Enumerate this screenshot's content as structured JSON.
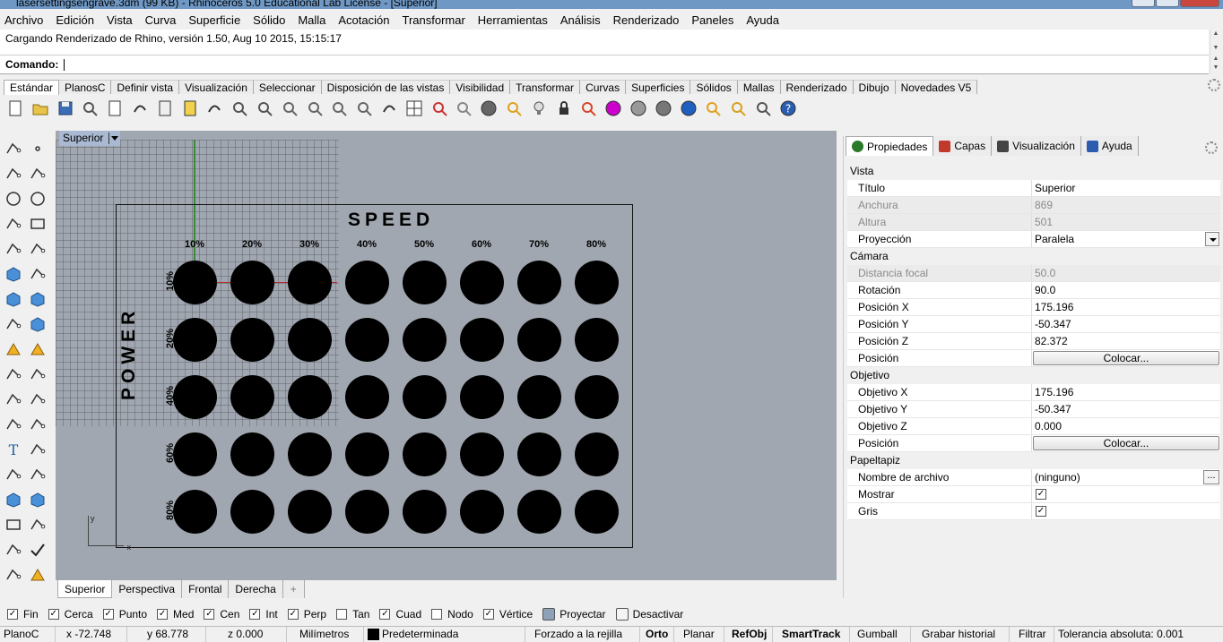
{
  "window": {
    "title": "lasersettingsengrave.3dm (99 KB) - Rhinoceros 5.0 Educational Lab License - [Superior]"
  },
  "menu": [
    "Archivo",
    "Edición",
    "Vista",
    "Curva",
    "Superficie",
    "Sólido",
    "Malla",
    "Acotación",
    "Transformar",
    "Herramientas",
    "Análisis",
    "Renderizado",
    "Paneles",
    "Ayuda"
  ],
  "command": {
    "history": "Cargando Renderizado de Rhino, versión 1.50, Aug 10 2015, 15:15:17",
    "prompt": "Comando:",
    "value": ""
  },
  "toolbar_tabs": [
    "Estándar",
    "PlanosC",
    "Definir vista",
    "Visualización",
    "Seleccionar",
    "Disposición de las vistas",
    "Visibilidad",
    "Transformar",
    "Curvas",
    "Superficies",
    "Sólidos",
    "Mallas",
    "Renderizado",
    "Dibujo",
    "Novedades V5"
  ],
  "active_toolbar_tab": "Estándar",
  "toolbar_icons": [
    "new-file-icon",
    "open-folder-icon",
    "save-icon",
    "print-icon",
    "import-icon",
    "cut-icon",
    "copy-icon",
    "paste-icon",
    "undo-icon",
    "pan-hand-icon",
    "rotate-view-icon",
    "zoom-dynamic-icon",
    "zoom-window-icon",
    "zoom-extents-icon",
    "zoom-selected-icon",
    "undo-view-icon",
    "four-viewports-icon",
    "car-shaded-icon",
    "render-preview-icon",
    "circle-select-icon",
    "properties-icon",
    "light-bulb-icon",
    "lock-icon",
    "layer-icon",
    "color-wheel-icon",
    "shaded-sphere-icon",
    "rendered-sphere-icon",
    "blue-sphere-icon",
    "filter-icon",
    "gear-settings-icon",
    "dimension-icon",
    "help-icon"
  ],
  "viewport": {
    "name": "Superior",
    "speed_label": "SPEED",
    "power_label": "POWER",
    "columns": [
      "10%",
      "20%",
      "30%",
      "40%",
      "50%",
      "60%",
      "70%",
      "80%"
    ],
    "rows": [
      "10%",
      "20%",
      "40%",
      "60%",
      "80%"
    ],
    "axis_x": "x",
    "axis_y": "y"
  },
  "viewport_tabs": [
    "Superior",
    "Perspectiva",
    "Frontal",
    "Derecha"
  ],
  "active_viewport_tab": "Superior",
  "panel": {
    "tabs": [
      {
        "label": "Propiedades",
        "icon": "properties-tab-icon",
        "color": "#2a7a2a"
      },
      {
        "label": "Capas",
        "icon": "layers-tab-icon",
        "color": "#c0392b"
      },
      {
        "label": "Visualización",
        "icon": "display-tab-icon",
        "color": "#444444"
      },
      {
        "label": "Ayuda",
        "icon": "help-tab-icon",
        "color": "#2a5db0"
      }
    ],
    "active_tab": "Propiedades",
    "sections": [
      {
        "title": "Vista",
        "rows": [
          {
            "key": "Título",
            "value": "Superior"
          },
          {
            "key": "Anchura",
            "value": "869",
            "disabled": true
          },
          {
            "key": "Altura",
            "value": "501",
            "disabled": true
          },
          {
            "key": "Proyección",
            "value": "Paralela",
            "type": "dropdown"
          }
        ]
      },
      {
        "title": "Cámara",
        "rows": [
          {
            "key": "Distancia focal",
            "value": "50.0",
            "disabled": true
          },
          {
            "key": "Rotación",
            "value": "90.0"
          },
          {
            "key": "Posición X",
            "value": "175.196"
          },
          {
            "key": "Posición Y",
            "value": "-50.347"
          },
          {
            "key": "Posición Z",
            "value": "82.372"
          },
          {
            "key": "Posición",
            "value": "Colocar...",
            "type": "button"
          }
        ]
      },
      {
        "title": "Objetivo",
        "rows": [
          {
            "key": "Objetivo X",
            "value": "175.196"
          },
          {
            "key": "Objetivo Y",
            "value": "-50.347"
          },
          {
            "key": "Objetivo Z",
            "value": "0.000"
          },
          {
            "key": "Posición",
            "value": "Colocar...",
            "type": "button"
          }
        ]
      },
      {
        "title": "Papeltapiz",
        "rows": [
          {
            "key": "Nombre de archivo",
            "value": "(ninguno)",
            "type": "browse",
            "browse_label": "..."
          },
          {
            "key": "Mostrar",
            "value": "✓",
            "type": "checkbox"
          },
          {
            "key": "Gris",
            "value": "✓",
            "type": "checkbox"
          }
        ]
      }
    ]
  },
  "osnaps": [
    {
      "label": "Fin",
      "checked": true
    },
    {
      "label": "Cerca",
      "checked": true
    },
    {
      "label": "Punto",
      "checked": true
    },
    {
      "label": "Med",
      "checked": true
    },
    {
      "label": "Cen",
      "checked": true
    },
    {
      "label": "Int",
      "checked": true
    },
    {
      "label": "Perp",
      "checked": true
    },
    {
      "label": "Tan",
      "checked": false
    },
    {
      "label": "Cuad",
      "checked": true
    },
    {
      "label": "Nodo",
      "checked": false
    },
    {
      "label": "Vértice",
      "checked": true
    }
  ],
  "osnap_toggles": [
    {
      "label": "Proyectar",
      "on": true
    },
    {
      "label": "Desactivar",
      "on": false
    }
  ],
  "statusbar": {
    "cplane": "PlanoC",
    "x": "x -72.748",
    "y": "y 68.778",
    "z": "z 0.000",
    "units": "Milímetros",
    "layer": "Predeterminada",
    "grid_snap": "Forzado a la rejilla",
    "ortho": "Orto",
    "planar": "Planar",
    "osnap": "RefObj",
    "smarttrack": "SmartTrack",
    "gumball": "Gumball",
    "record_history": "Grabar historial",
    "filter": "Filtrar",
    "tolerance": "Tolerancia absoluta: 0.001"
  }
}
